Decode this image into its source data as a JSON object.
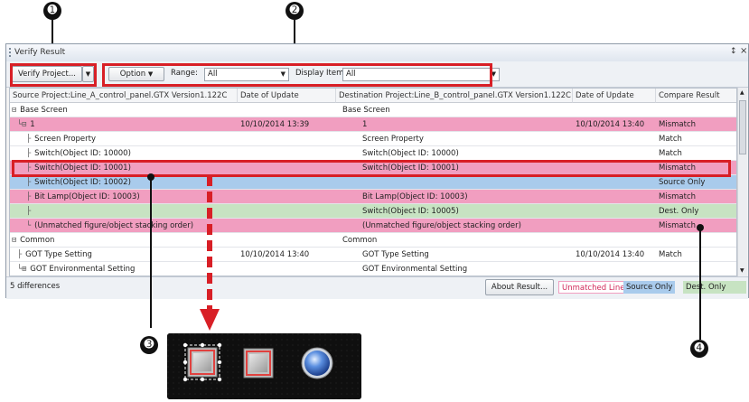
{
  "window": {
    "title": "Verify Result",
    "pin": "↕",
    "close": "×"
  },
  "toolbar": {
    "verify_label": "Verify Project...",
    "option_label": "Option",
    "range_label": "Range:",
    "range_value": "All",
    "display_label": "Display Items:",
    "display_value": "All"
  },
  "table": {
    "headers": [
      "Source Project:Line_A_control_panel.GTX  Version1.122C",
      "Date of Update",
      "Destination Project:Line_B_control_panel.GTX  Version1.122C",
      "Date of Update",
      "Compare Result"
    ],
    "rows": [
      {
        "tree": "⊟",
        "src": "Base Screen",
        "sdate": "",
        "dst": "Base Screen",
        "ddate": "",
        "result": ""
      },
      {
        "tree": "└⊟",
        "src": "1",
        "sdate": "10/10/2014 13:39",
        "dst": "1",
        "ddate": "10/10/2014 13:40",
        "result": "Mismatch"
      },
      {
        "tree": "├",
        "src": "Screen Property",
        "sdate": "",
        "dst": "Screen Property",
        "ddate": "",
        "result": "Match"
      },
      {
        "tree": "├",
        "src": "Switch(Object ID: 10000)",
        "sdate": "",
        "dst": "Switch(Object ID: 10000)",
        "ddate": "",
        "result": "Match"
      },
      {
        "tree": "├",
        "src": "Switch(Object ID: 10001)",
        "sdate": "",
        "dst": "Switch(Object ID: 10001)",
        "ddate": "",
        "result": "Mismatch"
      },
      {
        "tree": "├",
        "src": "Switch(Object ID: 10002)",
        "sdate": "",
        "dst": "",
        "ddate": "",
        "result": "Source Only"
      },
      {
        "tree": "├",
        "src": "Bit Lamp(Object ID: 10003)",
        "sdate": "",
        "dst": "Bit Lamp(Object ID: 10003)",
        "ddate": "",
        "result": "Mismatch"
      },
      {
        "tree": "├",
        "src": "",
        "sdate": "",
        "dst": "Switch(Object ID: 10005)",
        "ddate": "",
        "result": "Dest. Only"
      },
      {
        "tree": "└",
        "src": "(Unmatched figure/object stacking order)",
        "sdate": "",
        "dst": "(Unmatched figure/object stacking order)",
        "ddate": "",
        "result": "Mismatch"
      },
      {
        "tree": "⊟",
        "src": "Common",
        "sdate": "",
        "dst": "Common",
        "ddate": "",
        "result": ""
      },
      {
        "tree": "├",
        "src": "GOT Type Setting",
        "sdate": "10/10/2014 13:40",
        "dst": "GOT Type Setting",
        "ddate": "10/10/2014 13:40",
        "result": "Match"
      },
      {
        "tree": "└⊞",
        "src": "GOT Environmental Setting",
        "sdate": "",
        "dst": "GOT Environmental Setting",
        "ddate": "",
        "result": ""
      }
    ]
  },
  "status": {
    "count": "5 differences",
    "about_label": "About Result...",
    "legend_unmatched": "Unmatched Line",
    "legend_source": "Source Only",
    "legend_dest": "Dest. Only"
  },
  "callouts": [
    "➊",
    "➋",
    "➌",
    "➍"
  ],
  "colors": {
    "mismatch": "#f19ec0",
    "source_only": "#a9cbec",
    "dest_only": "#c7e3c2",
    "annotation_red": "#d81f26"
  }
}
